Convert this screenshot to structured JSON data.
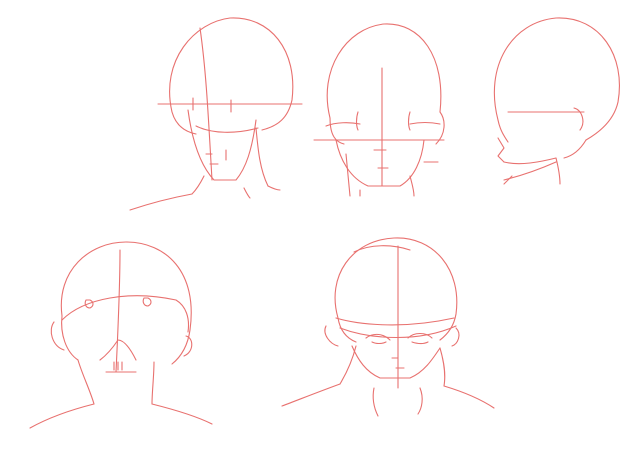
{
  "sketch": {
    "stroke_color": "#e8716f",
    "background_color": "#ffffff",
    "heads": [
      {
        "view": "front-tilted"
      },
      {
        "view": "front"
      },
      {
        "view": "side-three-quarter"
      },
      {
        "view": "top-down"
      },
      {
        "view": "bottom-up"
      }
    ]
  }
}
